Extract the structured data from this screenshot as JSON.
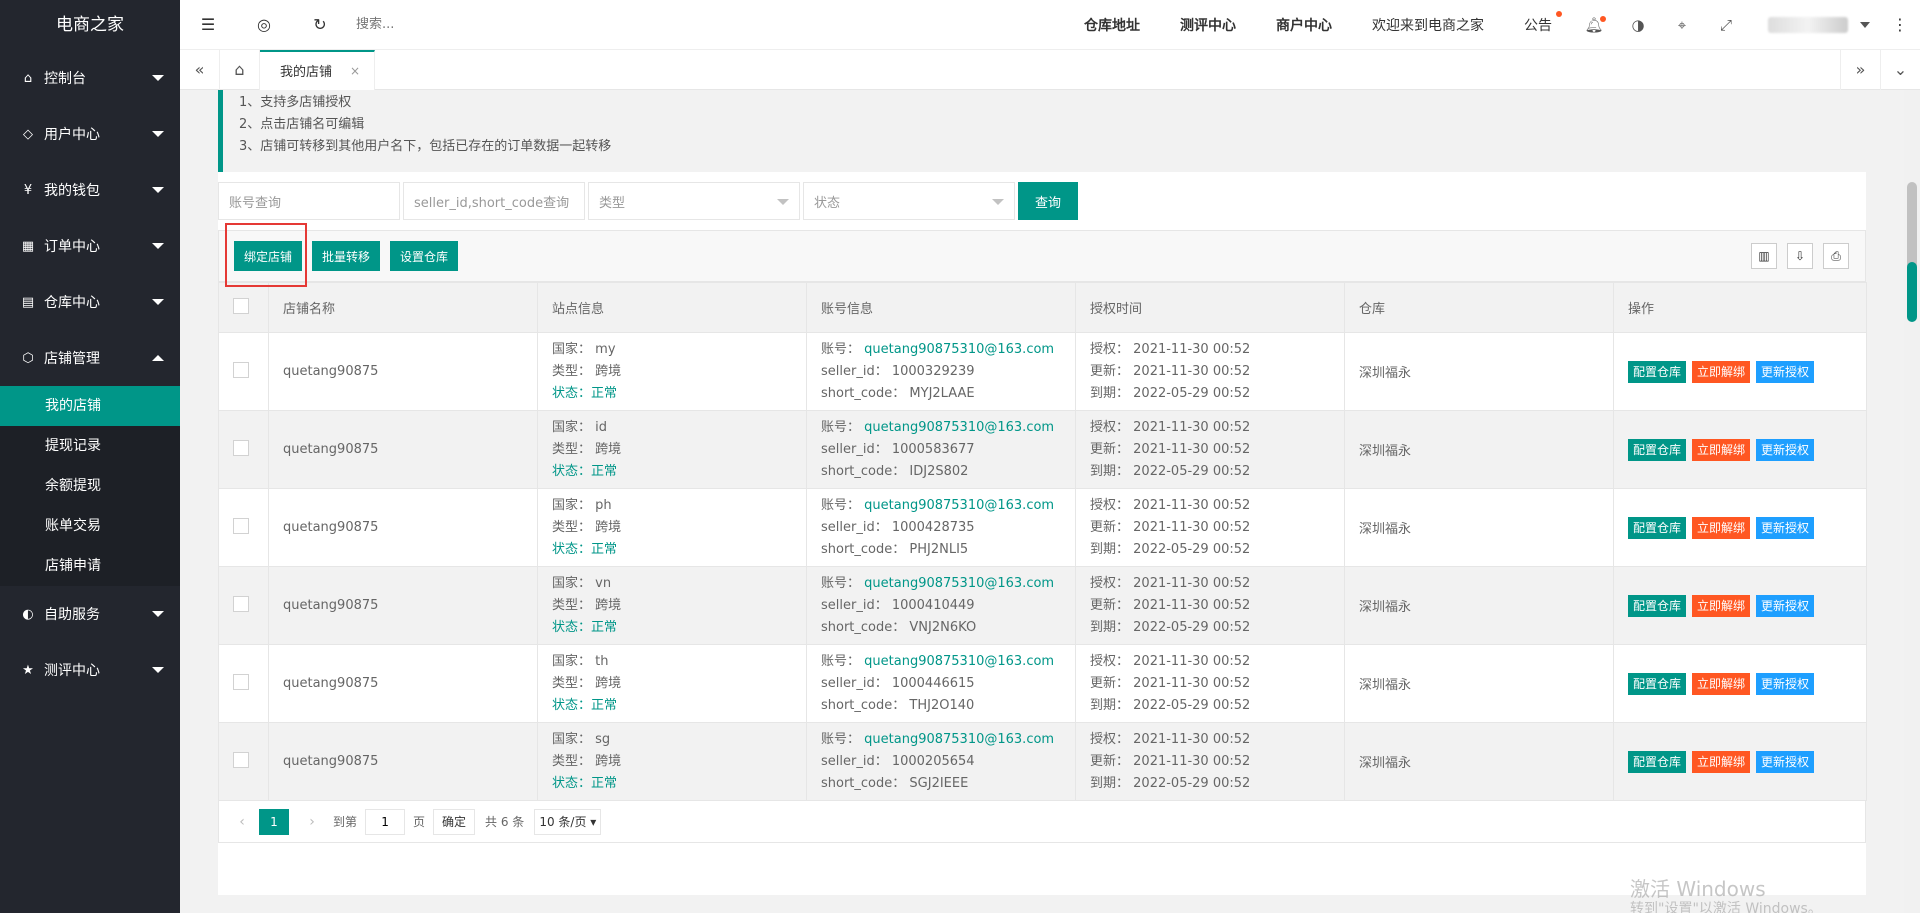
{
  "app": {
    "title": "电商之家"
  },
  "sidebar": {
    "items": [
      {
        "label": "控制台",
        "icon": "home-icon"
      },
      {
        "label": "用户中心",
        "icon": "diamond-icon"
      },
      {
        "label": "我的钱包",
        "icon": "yuan-icon"
      },
      {
        "label": "订单中心",
        "icon": "grid-icon"
      },
      {
        "label": "仓库中心",
        "icon": "warehouse-icon"
      },
      {
        "label": "店铺管理",
        "icon": "cube-icon"
      },
      {
        "label": "自助服务",
        "icon": "service-icon"
      },
      {
        "label": "测评中心",
        "icon": "star-icon"
      }
    ],
    "submenu": [
      "我的店铺",
      "提现记录",
      "余额提现",
      "账单交易",
      "店铺申请"
    ]
  },
  "header": {
    "search_placeholder": "搜索...",
    "links": [
      "仓库地址",
      "测评中心",
      "商户中心",
      "欢迎来到电商之家",
      "公告"
    ]
  },
  "tabs": {
    "current": "我的店铺",
    "close": "×"
  },
  "notice": [
    "1、支持多店铺授权",
    "2、点击店铺名可编辑",
    "3、店铺可转移到其他用户名下，包括已存在的订单数据一起转移"
  ],
  "filters": {
    "account_placeholder": "账号查询",
    "seller_placeholder": "seller_id,short_code查询",
    "type_placeholder": "类型",
    "status_placeholder": "状态",
    "query_label": "查询"
  },
  "toolbar": {
    "bind": "绑定店铺",
    "batch": "批量转移",
    "warehouse": "设置仓库"
  },
  "table": {
    "columns": [
      "店铺名称",
      "站点信息",
      "账号信息",
      "授权时间",
      "仓库",
      "操作"
    ],
    "labels": {
      "country": "国家：",
      "type": "类型：",
      "status": "状态：",
      "account": "账号：",
      "seller_id": "seller_id：",
      "short_code": "short_code：",
      "auth": "授权：",
      "update": "更新：",
      "expire": "到期："
    },
    "actions": {
      "config": "配置仓库",
      "unbind": "立即解绑",
      "renew": "更新授权"
    },
    "rows": [
      {
        "name": "quetang90875",
        "country": "my",
        "type": "跨境",
        "status": "正常",
        "account": "quetang90875310@163.com",
        "seller_id": "1000329239",
        "short_code": "MYJ2LAAE",
        "auth": "2021-11-30 00:52",
        "update": "2021-11-30 00:52",
        "expire": "2022-05-29 00:52",
        "warehouse": "深圳福永"
      },
      {
        "name": "quetang90875",
        "country": "id",
        "type": "跨境",
        "status": "正常",
        "account": "quetang90875310@163.com",
        "seller_id": "1000583677",
        "short_code": "IDJ2S802",
        "auth": "2021-11-30 00:52",
        "update": "2021-11-30 00:52",
        "expire": "2022-05-29 00:52",
        "warehouse": "深圳福永"
      },
      {
        "name": "quetang90875",
        "country": "ph",
        "type": "跨境",
        "status": "正常",
        "account": "quetang90875310@163.com",
        "seller_id": "1000428735",
        "short_code": "PHJ2NLI5",
        "auth": "2021-11-30 00:52",
        "update": "2021-11-30 00:52",
        "expire": "2022-05-29 00:52",
        "warehouse": "深圳福永"
      },
      {
        "name": "quetang90875",
        "country": "vn",
        "type": "跨境",
        "status": "正常",
        "account": "quetang90875310@163.com",
        "seller_id": "1000410449",
        "short_code": "VNJ2N6KO",
        "auth": "2021-11-30 00:52",
        "update": "2021-11-30 00:52",
        "expire": "2022-05-29 00:52",
        "warehouse": "深圳福永"
      },
      {
        "name": "quetang90875",
        "country": "th",
        "type": "跨境",
        "status": "正常",
        "account": "quetang90875310@163.com",
        "seller_id": "1000446615",
        "short_code": "THJ2O140",
        "auth": "2021-11-30 00:52",
        "update": "2021-11-30 00:52",
        "expire": "2022-05-29 00:52",
        "warehouse": "深圳福永"
      },
      {
        "name": "quetang90875",
        "country": "sg",
        "type": "跨境",
        "status": "正常",
        "account": "quetang90875310@163.com",
        "seller_id": "1000205654",
        "short_code": "SGJ2IEEE",
        "auth": "2021-11-30 00:52",
        "update": "2021-11-30 00:52",
        "expire": "2022-05-29 00:52",
        "warehouse": "深圳福永"
      }
    ]
  },
  "pager": {
    "current": "1",
    "goto": "到第",
    "page_input": "1",
    "page_unit": "页",
    "confirm": "确定",
    "total": "共 6 条",
    "per_page": "10 条/页"
  },
  "watermark": {
    "line1": "激活 Windows",
    "line2": "转到\"设置\"以激活 Windows。"
  },
  "colors": {
    "primary": "#009688",
    "sidebar": "#23262e",
    "orange": "#ff5722",
    "blue": "#1e9fff"
  }
}
